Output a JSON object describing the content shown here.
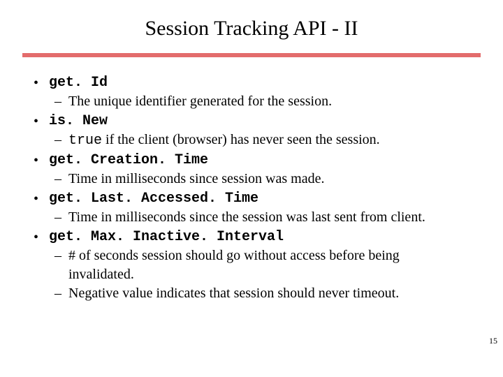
{
  "slide": {
    "title": "Session Tracking API - II",
    "page_number": "15"
  },
  "items": [
    {
      "name": "get. Id",
      "subs": [
        {
          "text": "The unique identifier generated for the session."
        }
      ]
    },
    {
      "name": "is. New",
      "subs": [
        {
          "code": "true",
          "text": " if the client (browser) has never seen the session."
        }
      ]
    },
    {
      "name": "get. Creation. Time",
      "subs": [
        {
          "text": "Time in milliseconds since session was made."
        }
      ]
    },
    {
      "name": "get. Last. Accessed. Time",
      "subs": [
        {
          "text": "Time in milliseconds since the session was last sent from client."
        }
      ]
    },
    {
      "name": "get. Max. Inactive. Interval",
      "subs": [
        {
          "text": "# of seconds session should go without access before being invalidated."
        },
        {
          "text": "Negative value indicates that session should never timeout."
        }
      ]
    }
  ]
}
